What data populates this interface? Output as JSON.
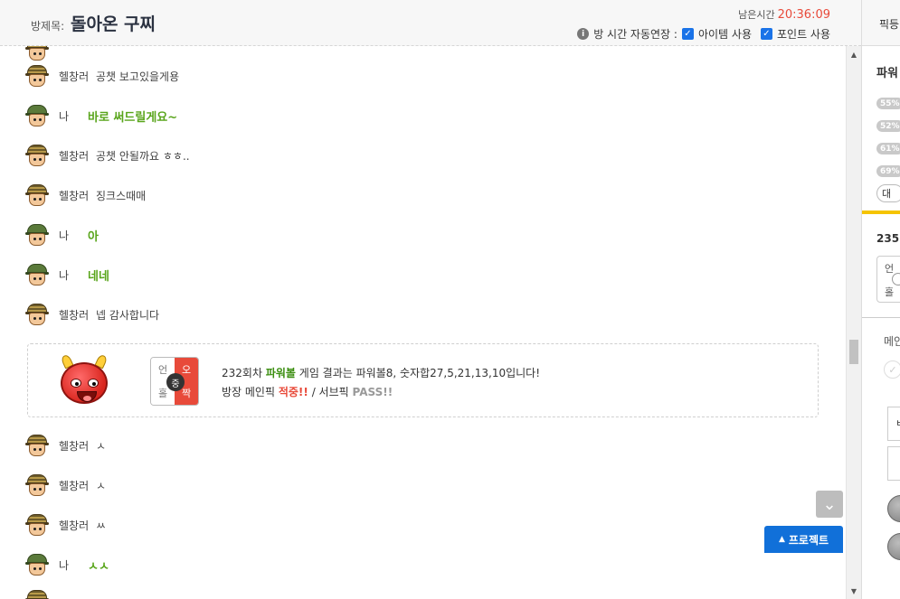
{
  "header": {
    "room_label": "방제목:",
    "room_title": "돌아온 구찌",
    "remain_label": "남은시간",
    "remain_time": "20:36:09",
    "auto_extend_label": "방 시간 자동연장 :",
    "item_label": "아이템 사용",
    "point_label": "포인트 사용",
    "item_checked": true,
    "point_checked": true
  },
  "messages_top": [
    {
      "user": "헬창러",
      "type": "other",
      "text": "공챗 보고있을게용"
    },
    {
      "user": "나",
      "type": "me",
      "text": "바로 써드릴게요~"
    },
    {
      "user": "헬창러",
      "type": "other",
      "text": "공챗 안될까요 ㅎㅎ.."
    },
    {
      "user": "헬창러",
      "type": "other",
      "text": "징크스때매"
    },
    {
      "user": "나",
      "type": "me",
      "text": "아"
    },
    {
      "user": "나",
      "type": "me",
      "text": "네네"
    },
    {
      "user": "헬창러",
      "type": "other",
      "text": "넵 감사합니다"
    }
  ],
  "result": {
    "pick_cells": [
      "언",
      "오",
      "홀",
      "짝"
    ],
    "pick_center": "중",
    "line1_prefix": "232회차",
    "line1_game": "파워볼",
    "line1_rest": "게임 결과는 파워볼8, 숫자합27,5,21,13,10입니다!",
    "line2_prefix": "방장 메인픽",
    "line2_main_result": "적중!!",
    "line2_mid": "/ 서브픽",
    "line2_sub_result": "PASS!!"
  },
  "messages_bottom": [
    {
      "user": "헬창러",
      "type": "other",
      "text": "ㅅ"
    },
    {
      "user": "헬창러",
      "type": "other",
      "text": "ㅅ"
    },
    {
      "user": "헬창러",
      "type": "other",
      "text": "ㅆ"
    },
    {
      "user": "나",
      "type": "me",
      "text": "ㅅㅅ"
    }
  ],
  "buttons": {
    "protect_label": "프로젝트",
    "scroll_down_icon": "chevron-down-icon"
  },
  "right_panel": {
    "top_label": "픽등",
    "title": "파워",
    "percents": [
      "55%",
      "52%",
      "61%",
      "69%"
    ],
    "big_label": "대",
    "round_label": "235",
    "grid_top": "언",
    "grid_bottom": "홀",
    "main_label": "메인",
    "input_label": "ㅂ"
  },
  "colors": {
    "accent_blue": "#1170d9",
    "me_green": "#59a51b",
    "time_red": "#e84a3a",
    "yellow_bar": "#f5c400"
  }
}
